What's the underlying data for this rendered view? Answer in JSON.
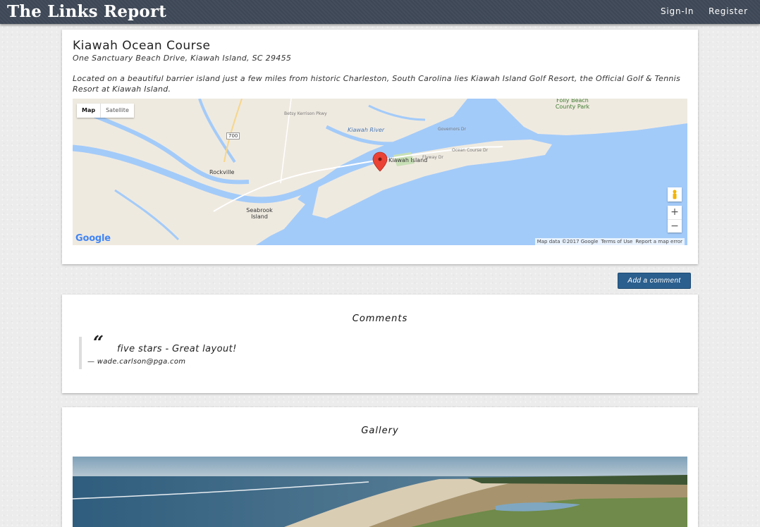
{
  "nav": {
    "brand": "The Links Report",
    "signin": "Sign-In",
    "register": "Register"
  },
  "course": {
    "title": "Kiawah Ocean Course",
    "address": "One Sanctuary Beach Drive, Kiawah Island, SC 29455",
    "description": "Located on a beautiful barrier island just a few miles from historic Charleston, South Carolina lies Kiawah Island Golf Resort, the Official Golf & Tennis Resort at Kiawah Island."
  },
  "map": {
    "type_map": "Map",
    "type_satellite": "Satellite",
    "zoom_in": "+",
    "zoom_out": "−",
    "footer_data": "Map data ©2017 Google",
    "footer_terms": "Terms of Use",
    "footer_report": "Report a map error",
    "google_logo": "Google",
    "labels": {
      "rockville": "Rockville",
      "seabrook": "Seabrook Island",
      "kiawah_island": "Kiawah Island",
      "kiawah_river": "Kiawah River",
      "folly_beach": "Folly Beach County Park",
      "route_700": "700",
      "betsy_kerrison": "Betsy Kerrison Pkwy",
      "flyway_dr": "Flyway Dr",
      "ocean_course_dr": "Ocean Course Dr",
      "governors_dr": "Governors Dr"
    },
    "colors": {
      "water": "#a3cbf9",
      "land": "#efeae0",
      "park": "#c8e0b6"
    }
  },
  "actions": {
    "add_comment": "Add a comment"
  },
  "comments": {
    "heading": "Comments",
    "quote_glyph": "“",
    "items": [
      {
        "rating": "five stars",
        "separator": " - ",
        "text": "Great layout!",
        "author": "— wade.carlson@pga.com"
      }
    ]
  },
  "gallery": {
    "heading": "Gallery"
  }
}
